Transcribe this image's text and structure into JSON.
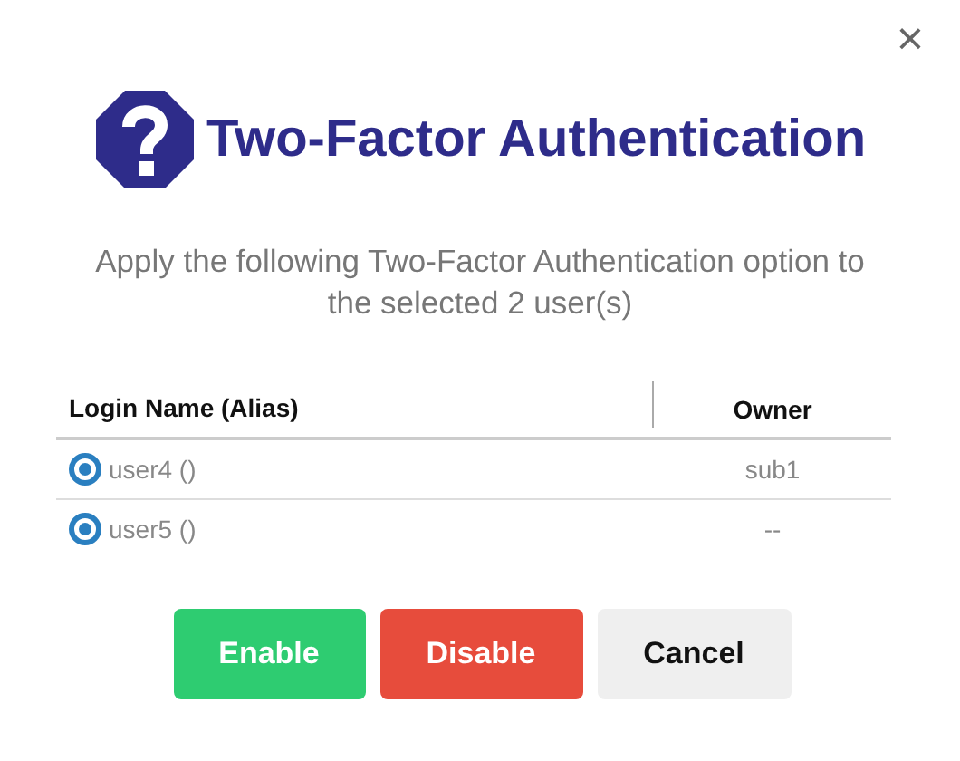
{
  "dialog": {
    "close": "×",
    "title": "Two-Factor Authentication",
    "message": "Apply the following Two-Factor Authentication option to the selected 2 user(s)"
  },
  "table": {
    "columns": [
      "Login Name (Alias)",
      "Owner"
    ],
    "rows": [
      {
        "login": "user4 ()",
        "owner": "sub1"
      },
      {
        "login": "user5 ()",
        "owner": "--"
      }
    ]
  },
  "buttons": [
    {
      "label": "Enable",
      "kind": "success"
    },
    {
      "label": "Disable",
      "kind": "danger"
    },
    {
      "label": "Cancel",
      "kind": "default"
    }
  ]
}
